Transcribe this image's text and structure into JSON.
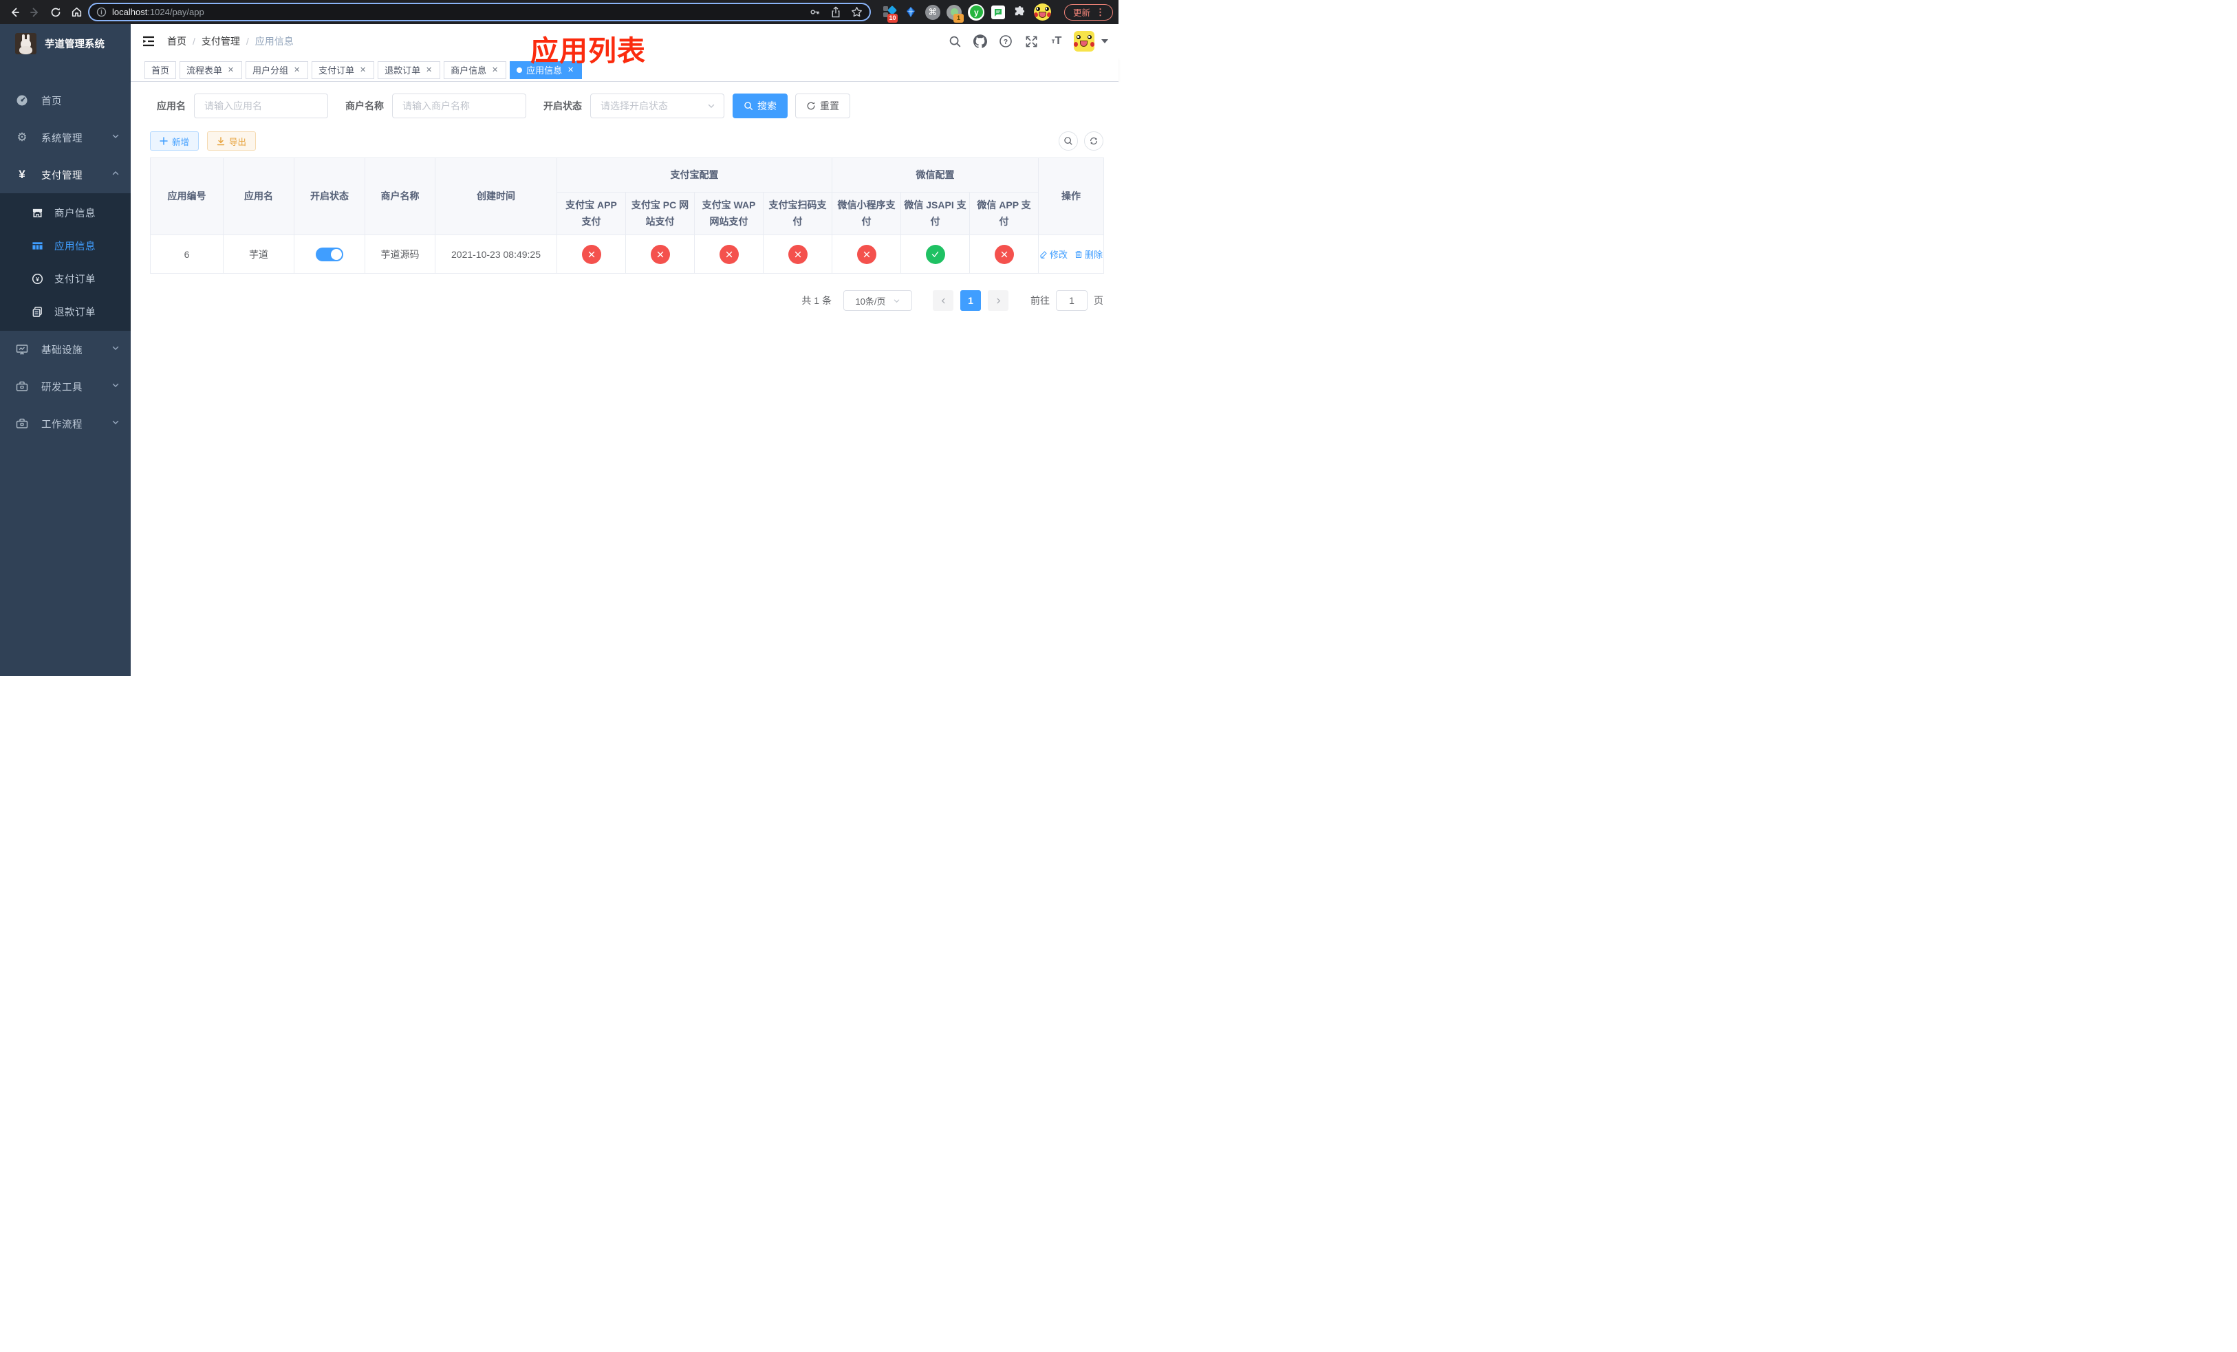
{
  "colors": {
    "accent": "#409eff",
    "danger": "#f4514d",
    "success": "#1fc163",
    "warning": "#e6a23c",
    "overlay_title": "#fb2b0e",
    "sidebar_bg": "#304156",
    "submenu_bg": "#1f2d3d"
  },
  "browser": {
    "url_host": "localhost",
    "url_path": ":1024/pay/app",
    "ext_badge_diamond": "10",
    "ext_badge_camera": "1",
    "update_label": "更新"
  },
  "sidebar": {
    "title": "芋道管理系统",
    "items": [
      {
        "label": "首页"
      },
      {
        "label": "系统管理"
      },
      {
        "label": "支付管理"
      },
      {
        "label": "商户信息"
      },
      {
        "label": "应用信息"
      },
      {
        "label": "支付订单"
      },
      {
        "label": "退款订单"
      },
      {
        "label": "基础设施"
      },
      {
        "label": "研发工具"
      },
      {
        "label": "工作流程"
      }
    ]
  },
  "header": {
    "breadcrumb": [
      "首页",
      "支付管理",
      "应用信息"
    ],
    "overlay_title": "应用列表"
  },
  "tabs": [
    {
      "label": "首页"
    },
    {
      "label": "流程表单"
    },
    {
      "label": "用户分组"
    },
    {
      "label": "支付订单"
    },
    {
      "label": "退款订单"
    },
    {
      "label": "商户信息"
    },
    {
      "label": "应用信息"
    }
  ],
  "filters": {
    "app_name_label": "应用名",
    "app_name_placeholder": "请输入应用名",
    "merchant_label": "商户名称",
    "merchant_placeholder": "请输入商户名称",
    "status_label": "开启状态",
    "status_placeholder": "请选择开启状态",
    "search_label": "搜索",
    "reset_label": "重置"
  },
  "toolbar": {
    "add_label": "新增",
    "export_label": "导出"
  },
  "table": {
    "groups": {
      "alipay": "支付宝配置",
      "wechat": "微信配置"
    },
    "columns": {
      "id": "应用编号",
      "name": "应用名",
      "status": "开启状态",
      "merchant": "商户名称",
      "created": "创建时间",
      "alipay_app": "支付宝 APP 支付",
      "alipay_pc": "支付宝 PC 网站支付",
      "alipay_wap": "支付宝 WAP 网站支付",
      "alipay_qr": "支付宝扫码支付",
      "wx_lite": "微信小程序支付",
      "wx_jsapi": "微信 JSAPI 支付",
      "wx_app": "微信 APP 支付",
      "actions": "操作"
    },
    "row": {
      "id": "6",
      "name": "芋道",
      "enabled": true,
      "merchant": "芋道源码",
      "created": "2021-10-23 08:49:25",
      "statuses": [
        false,
        false,
        false,
        false,
        false,
        true,
        false
      ],
      "edit_label": "修改",
      "delete_label": "删除"
    }
  },
  "pagination": {
    "total": "共 1 条",
    "page_size": "10条/页",
    "page": "1",
    "goto_label": "前往",
    "goto_value": "1",
    "unit_label": "页"
  }
}
